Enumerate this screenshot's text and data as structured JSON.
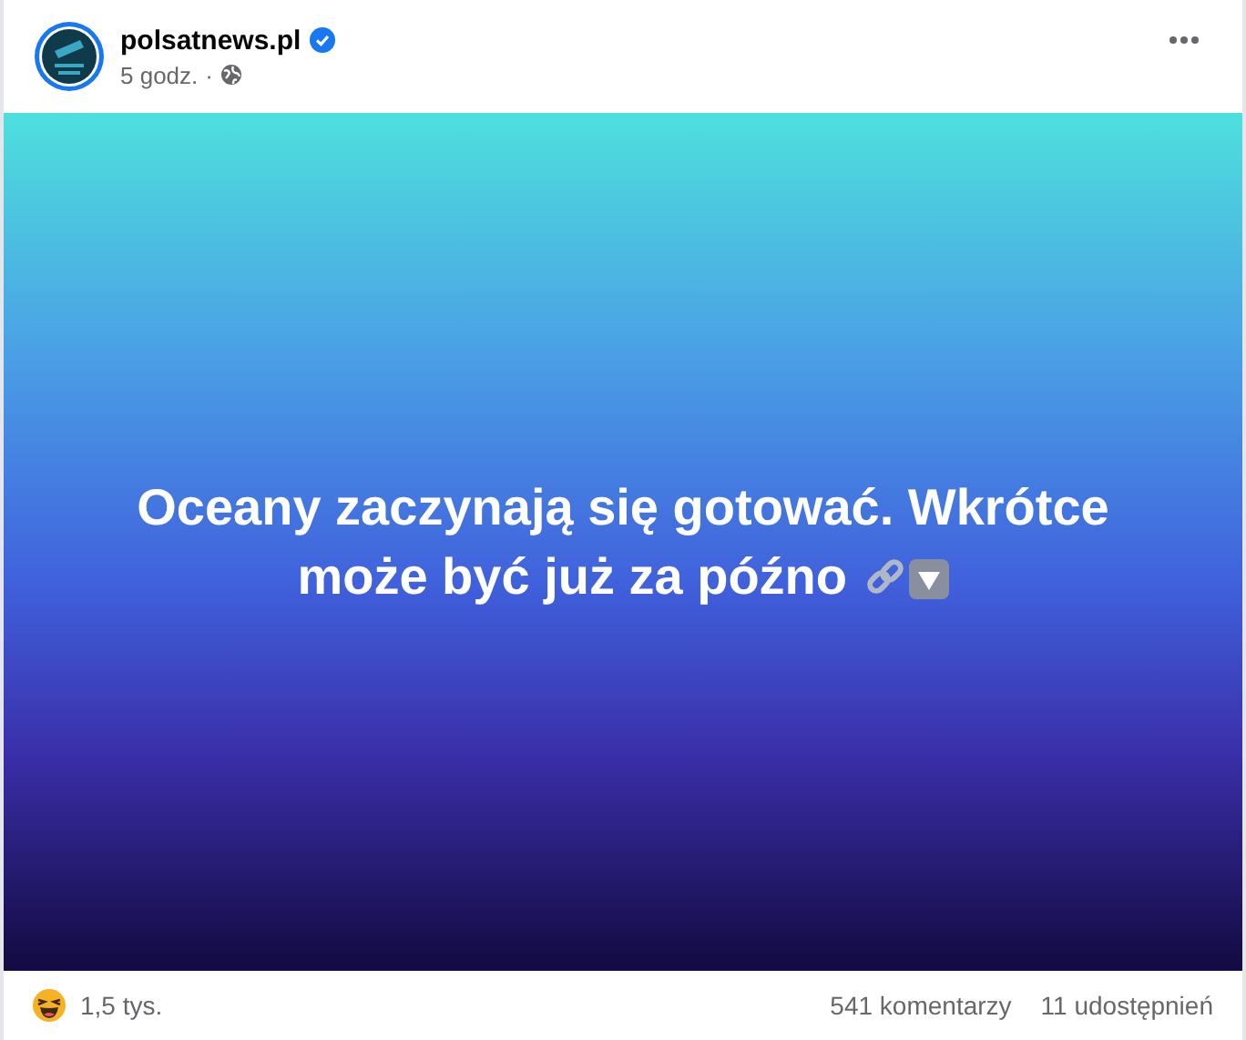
{
  "post": {
    "author": "polsatnews.pl",
    "verified": true,
    "time": "5 godz.",
    "separator": "·",
    "public": true
  },
  "banner": {
    "headline": "Oceany zaczynają się gotować. Wkrótce może być już za późno",
    "emoji": [
      {
        "kind": "link"
      },
      {
        "kind": "down"
      }
    ]
  },
  "footer": {
    "reactions": "1,5 tys.",
    "comments": "541 komentarzy",
    "shares": "11 udostępnień"
  }
}
